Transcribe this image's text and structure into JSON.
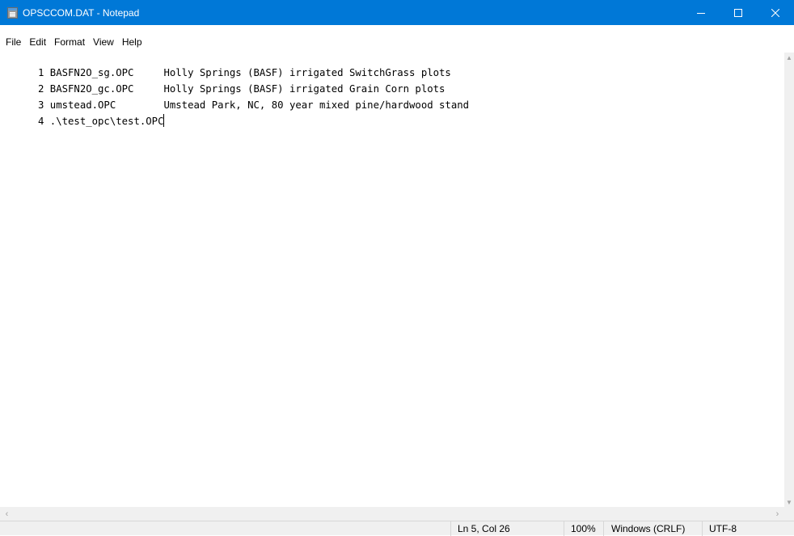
{
  "window": {
    "title": "OPSCCOM.DAT - Notepad",
    "controls": {
      "minimize": "—",
      "maximize": "☐",
      "close": "✕"
    }
  },
  "menu": [
    "File",
    "Edit",
    "Format",
    "View",
    "Help"
  ],
  "editor": {
    "lines": [
      "1 BASFN2O_sg.OPC     Holly Springs (BASF) irrigated SwitchGrass plots",
      "2 BASFN2O_gc.OPC     Holly Springs (BASF) irrigated Grain Corn plots",
      "3 umstead.OPC        Umstead Park, NC, 80 year mixed pine/hardwood stand",
      "4 .\\test_opc\\test.OPC"
    ]
  },
  "scrollbars": {
    "up": "▲",
    "down": "▼",
    "left": "‹",
    "right": "›"
  },
  "status": {
    "position": "Ln 5, Col 26",
    "zoom": "100%",
    "line_endings": "Windows (CRLF)",
    "encoding": "UTF-8"
  },
  "icons": {
    "app": "notepad-icon"
  },
  "colors": {
    "titlebar": "#0078d7",
    "statusbar": "#f0f0f0"
  }
}
